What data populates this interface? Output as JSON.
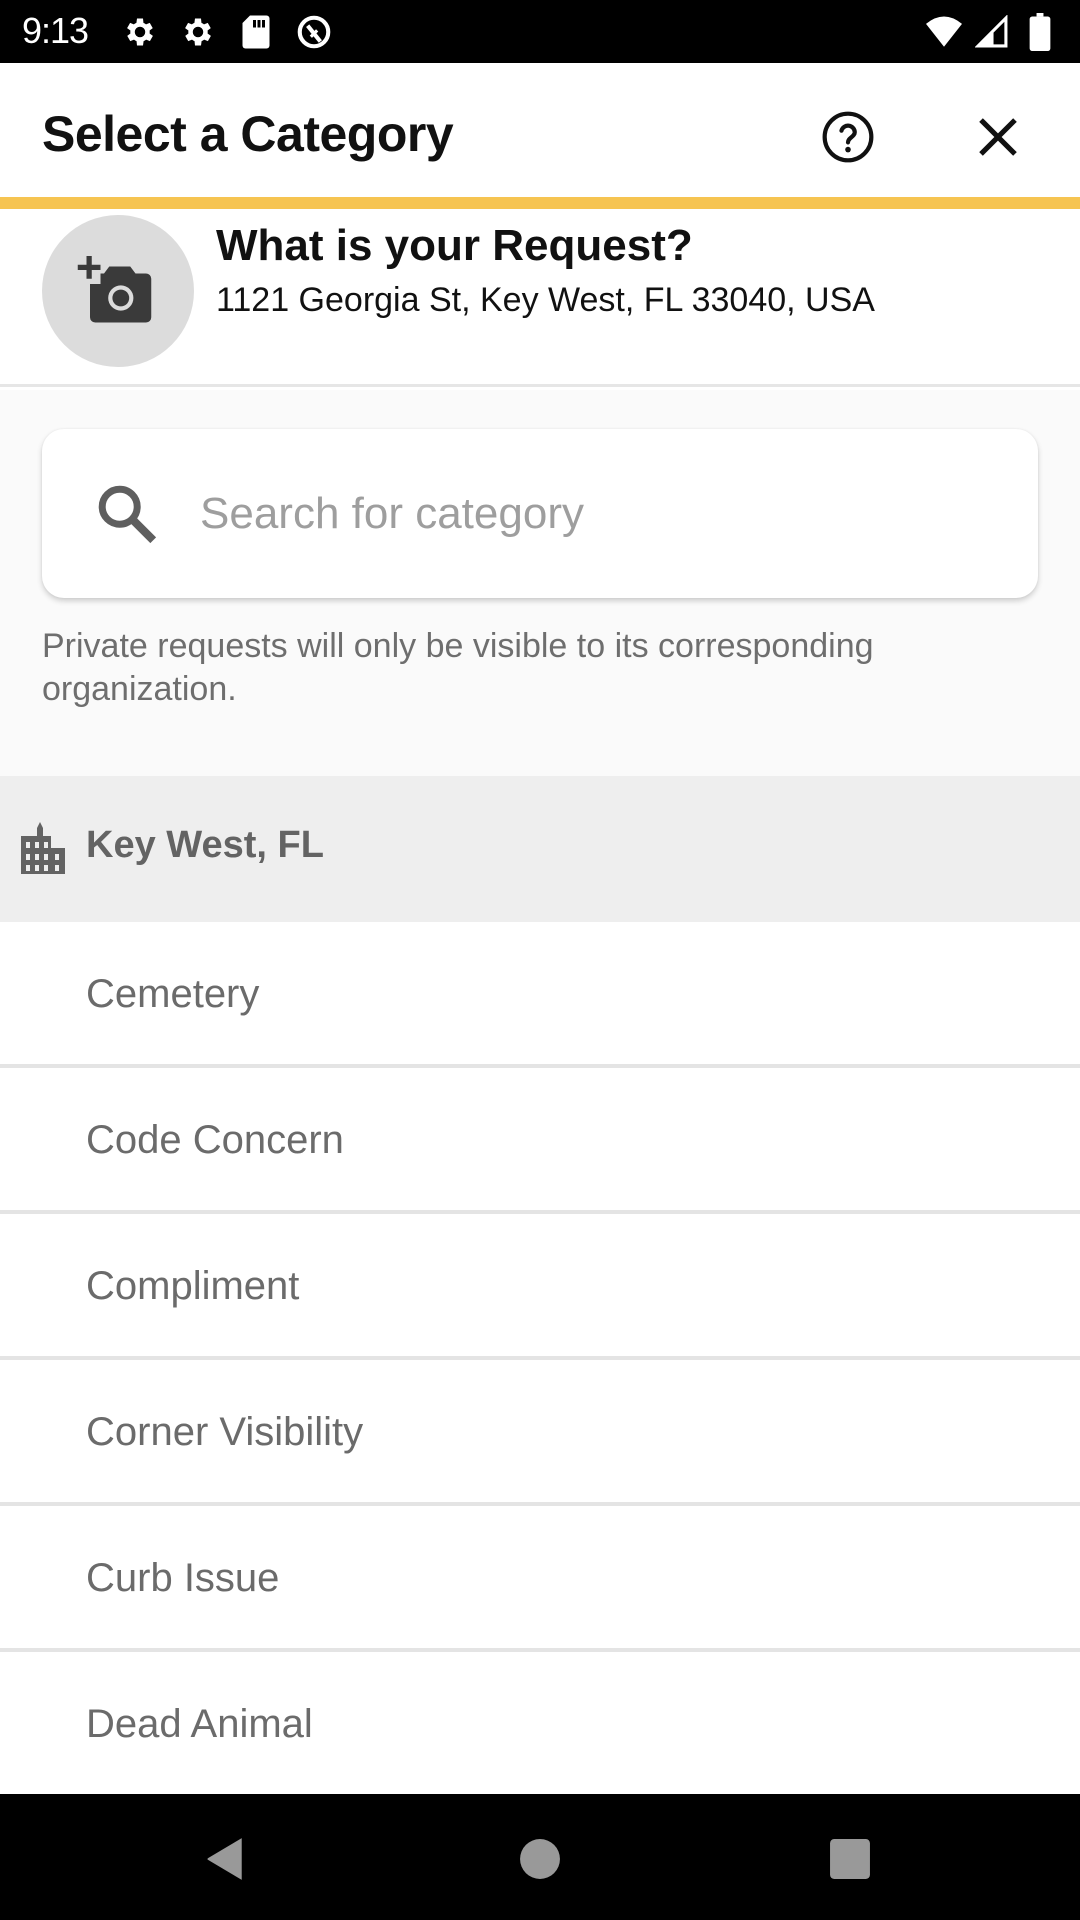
{
  "status_bar": {
    "time": "9:13",
    "left_icons": [
      "settings-icon",
      "settings-icon",
      "sd-card-icon",
      "data-saver-icon"
    ],
    "right_icons": [
      "wifi-icon",
      "cell-signal-icon",
      "battery-icon"
    ]
  },
  "header": {
    "title": "Select a Category",
    "help_icon": "help-circle-icon",
    "close_icon": "close-icon",
    "accent_color": "#f6c451"
  },
  "request": {
    "photo_icon": "add-photo-icon",
    "title": "What is your Request?",
    "address": "1121 Georgia St, Key West, FL 33040, USA"
  },
  "search": {
    "placeholder": "Search for category",
    "value": ""
  },
  "private_note": "Private requests will only be visible to its corresponding organization.",
  "organization": {
    "icon": "city-building-icon",
    "name": "Key West, FL"
  },
  "categories": [
    {
      "label": "Cemetery"
    },
    {
      "label": "Code Concern"
    },
    {
      "label": "Compliment"
    },
    {
      "label": "Corner Visibility"
    },
    {
      "label": "Curb Issue"
    },
    {
      "label": "Dead Animal"
    }
  ],
  "nav_bar": {
    "buttons": [
      "back",
      "home",
      "recents"
    ]
  }
}
